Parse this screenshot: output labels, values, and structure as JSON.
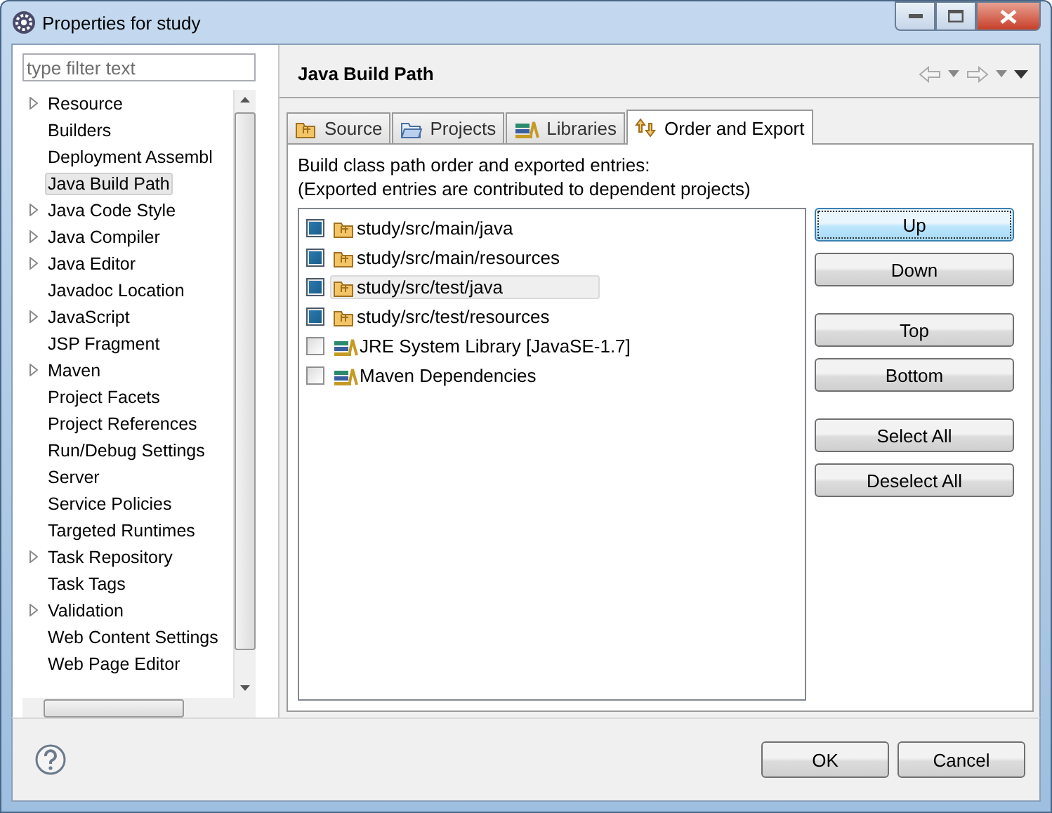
{
  "window": {
    "title": "Properties for study"
  },
  "filter": {
    "placeholder": "type filter text"
  },
  "sidebar": {
    "items": [
      {
        "label": "Resource",
        "expandable": true,
        "selected": false
      },
      {
        "label": "Builders",
        "expandable": false,
        "selected": false
      },
      {
        "label": "Deployment Assembl",
        "expandable": false,
        "selected": false
      },
      {
        "label": "Java Build Path",
        "expandable": false,
        "selected": true
      },
      {
        "label": "Java Code Style",
        "expandable": true,
        "selected": false
      },
      {
        "label": "Java Compiler",
        "expandable": true,
        "selected": false
      },
      {
        "label": "Java Editor",
        "expandable": true,
        "selected": false
      },
      {
        "label": "Javadoc Location",
        "expandable": false,
        "selected": false
      },
      {
        "label": "JavaScript",
        "expandable": true,
        "selected": false
      },
      {
        "label": "JSP Fragment",
        "expandable": false,
        "selected": false
      },
      {
        "label": "Maven",
        "expandable": true,
        "selected": false
      },
      {
        "label": "Project Facets",
        "expandable": false,
        "selected": false
      },
      {
        "label": "Project References",
        "expandable": false,
        "selected": false
      },
      {
        "label": "Run/Debug Settings",
        "expandable": false,
        "selected": false
      },
      {
        "label": "Server",
        "expandable": false,
        "selected": false
      },
      {
        "label": "Service Policies",
        "expandable": false,
        "selected": false
      },
      {
        "label": "Targeted Runtimes",
        "expandable": false,
        "selected": false
      },
      {
        "label": "Task Repository",
        "expandable": true,
        "selected": false
      },
      {
        "label": "Task Tags",
        "expandable": false,
        "selected": false
      },
      {
        "label": "Validation",
        "expandable": true,
        "selected": false
      },
      {
        "label": "Web Content Settings",
        "expandable": false,
        "selected": false
      },
      {
        "label": "Web Page Editor",
        "expandable": false,
        "selected": false
      }
    ]
  },
  "page": {
    "title": "Java Build Path",
    "tabs": [
      {
        "label": "Source",
        "kind": "source",
        "selected": false
      },
      {
        "label": "Projects",
        "kind": "projects",
        "selected": false
      },
      {
        "label": "Libraries",
        "kind": "library",
        "selected": false
      },
      {
        "label": "Order and Export",
        "kind": "order",
        "selected": true
      }
    ],
    "description": [
      "Build class path order and exported entries:",
      "(Exported entries are contributed to dependent projects)"
    ],
    "entries": [
      {
        "label": "study/src/main/java",
        "kind": "source",
        "checked": true,
        "selected": false
      },
      {
        "label": "study/src/main/resources",
        "kind": "source",
        "checked": true,
        "selected": false
      },
      {
        "label": "study/src/test/java",
        "kind": "source",
        "checked": true,
        "selected": true
      },
      {
        "label": "study/src/test/resources",
        "kind": "source",
        "checked": true,
        "selected": false
      },
      {
        "label": "JRE System Library [JavaSE-1.7]",
        "kind": "library",
        "checked": false,
        "selected": false
      },
      {
        "label": "Maven Dependencies",
        "kind": "library",
        "checked": false,
        "selected": false
      }
    ],
    "button_groups": [
      [
        {
          "label": "Up",
          "focused": true
        },
        {
          "label": "Down",
          "focused": false
        }
      ],
      [
        {
          "label": "Top",
          "focused": false
        },
        {
          "label": "Bottom",
          "focused": false
        }
      ],
      [
        {
          "label": "Select All",
          "focused": false
        },
        {
          "label": "Deselect All",
          "focused": false
        }
      ]
    ]
  },
  "dialog_buttons": [
    "OK",
    "Cancel"
  ]
}
